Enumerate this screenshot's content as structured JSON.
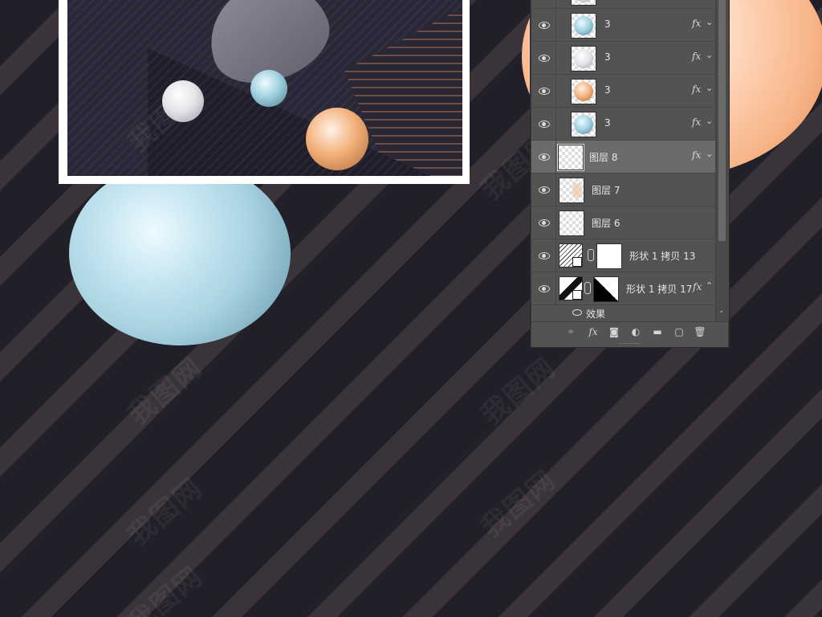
{
  "layers_panel": {
    "rows": [
      {
        "name": "3",
        "thumb": "blue-ball",
        "fx": "fx",
        "chevron": "⌄"
      },
      {
        "name": "3",
        "thumb": "white-ball",
        "fx": "fx",
        "chevron": "⌄"
      },
      {
        "name": "3",
        "thumb": "peach-ball",
        "fx": "fx",
        "chevron": "⌄"
      },
      {
        "name": "3",
        "thumb": "blue-ball",
        "fx": "fx",
        "chevron": "⌄"
      },
      {
        "name": "图层 8",
        "thumb": "transparent",
        "fx": "fx",
        "chevron": "⌄"
      },
      {
        "name": "图层 7",
        "thumb": "transparent-pale"
      },
      {
        "name": "图层 6",
        "thumb": "transparent"
      },
      {
        "name": "形状 1 拷贝 13",
        "thumb": "shape-mask"
      },
      {
        "name": "形状 1 拷贝 17",
        "thumb": "shape-mask-black",
        "fx": "fx",
        "chevron": "⌃"
      }
    ],
    "effect_label": "效果",
    "toolbar": {
      "link": "⚭",
      "fx": "fx",
      "mask": "◙",
      "adjust": "◐",
      "folder": "▬",
      "new": "▢",
      "trash": "🗑"
    }
  },
  "watermark_text": "我图网",
  "colors": {
    "panel_bg": "#535353",
    "selected_row": "#6b6b6b",
    "canvas_stripe": "#3b333a",
    "canvas_bg": "#211f27"
  }
}
